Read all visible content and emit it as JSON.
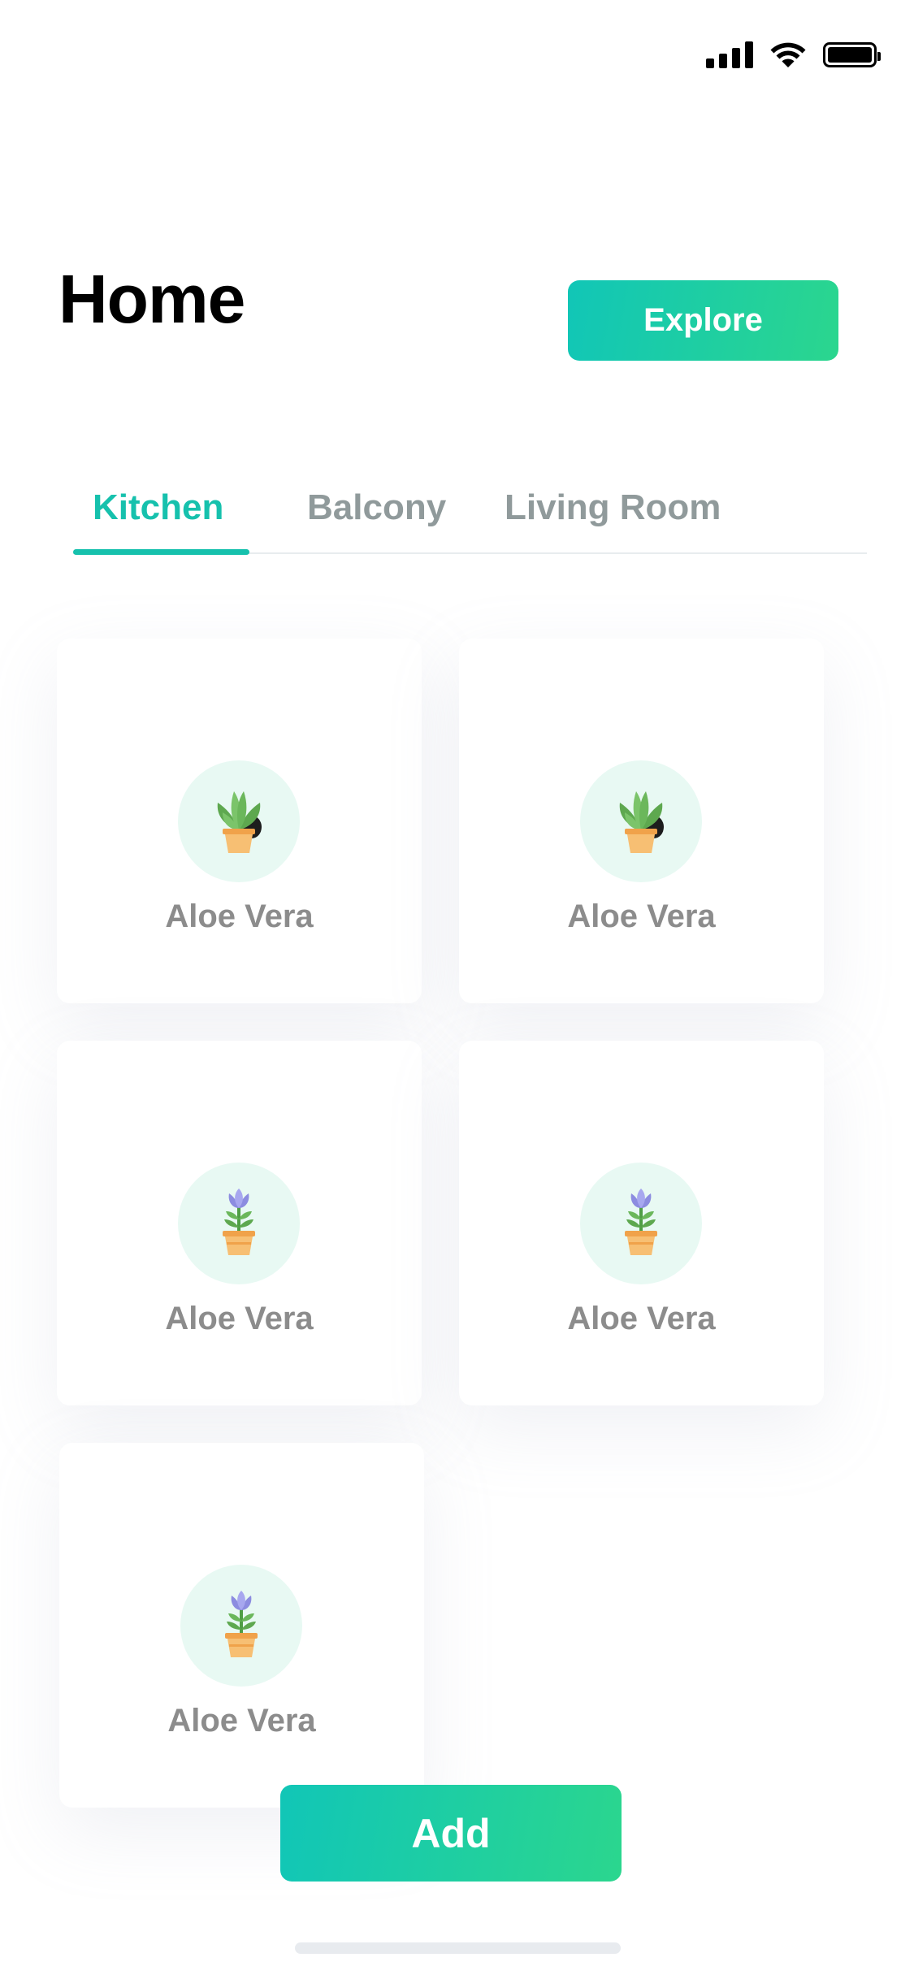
{
  "status_bar": {
    "icons": [
      "cellular-signal-icon",
      "wifi-icon",
      "battery-icon"
    ]
  },
  "header": {
    "title": "Home",
    "explore_label": "Explore"
  },
  "tabs": [
    {
      "label": "Kitchen",
      "active": true
    },
    {
      "label": "Balcony",
      "active": false
    },
    {
      "label": "Living Room",
      "active": false
    }
  ],
  "plants": [
    {
      "name": "Aloe Vera",
      "icon": "aloe-plant-icon"
    },
    {
      "name": "Aloe Vera",
      "icon": "aloe-plant-icon"
    },
    {
      "name": "Aloe Vera",
      "icon": "flower-plant-icon"
    },
    {
      "name": "Aloe Vera",
      "icon": "flower-plant-icon"
    },
    {
      "name": "Aloe Vera",
      "icon": "flower-plant-icon"
    }
  ],
  "actions": {
    "add_label": "Add"
  },
  "colors": {
    "accent": "#16c1ad",
    "gradient_start": "#11c6b7",
    "gradient_end": "#2bd68e",
    "inactive_tab": "#909a9b",
    "card_label": "#8c8c8c",
    "icon_circle": "#e8f9f3"
  }
}
